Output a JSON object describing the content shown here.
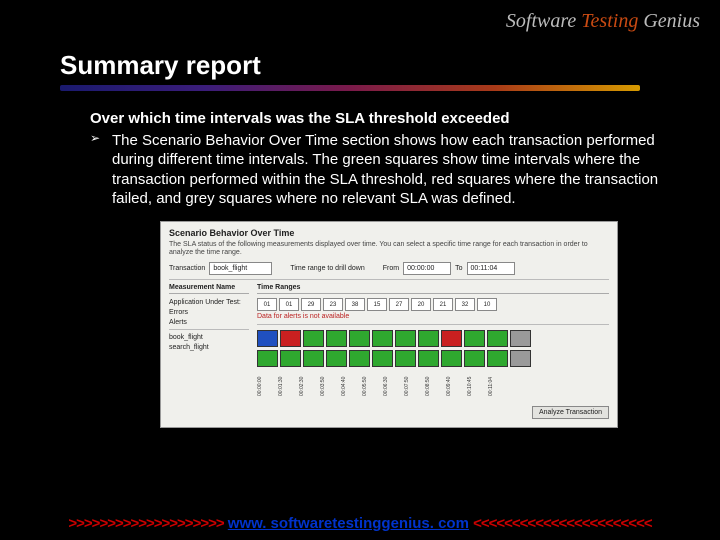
{
  "logo": {
    "w1": "Software",
    "w2": "Testing",
    "w3": "Genius"
  },
  "title": "Summary report",
  "heading": "Over which time intervals was the SLA threshold exceeded",
  "bullet": "The Scenario Behavior Over Time section shows how each transaction performed during different time intervals. The green squares show time intervals where the transaction performed within the SLA threshold, red squares where the transaction failed, and grey squares where no relevant SLA was defined.",
  "sb": {
    "title": "Scenario Behavior Over Time",
    "desc": "The SLA status of the following measurements displayed over time. You can select a specific time range for each transaction in order to analyze the time range.",
    "txn_label": "Transaction",
    "txn_value": "book_flight",
    "drill_label": "Time range to drill down",
    "from_label": "From",
    "from_value": "00:00:00",
    "to_label": "To",
    "to_value": "00:11:04",
    "col1": "Measurement Name",
    "col2": "Time Ranges",
    "rows": [
      "Application Under Test:",
      "Errors",
      "Alerts",
      "",
      "book_flight",
      "search_flight"
    ],
    "ticks": [
      "01",
      "01",
      "29",
      "23",
      "38",
      "15",
      "27",
      "20",
      "21",
      "32",
      "10"
    ],
    "note": "Data for alerts is not available",
    "xlabels": [
      "00:00:00",
      "00:01:30",
      "00:02:30",
      "00:03:50",
      "00:04:40",
      "00:05:50",
      "00:06:30",
      "00:07:50",
      "00:08:50",
      "00:09:40",
      "00:10:45",
      "00:11:04"
    ],
    "btn": "Analyze Transaction"
  },
  "footer": {
    "left": ">>>>>>>>>>>>>>>>>>>>",
    "url": "www. softwaretestinggenius. com",
    "right": "<<<<<<<<<<<<<<<<<<<<<<<"
  }
}
